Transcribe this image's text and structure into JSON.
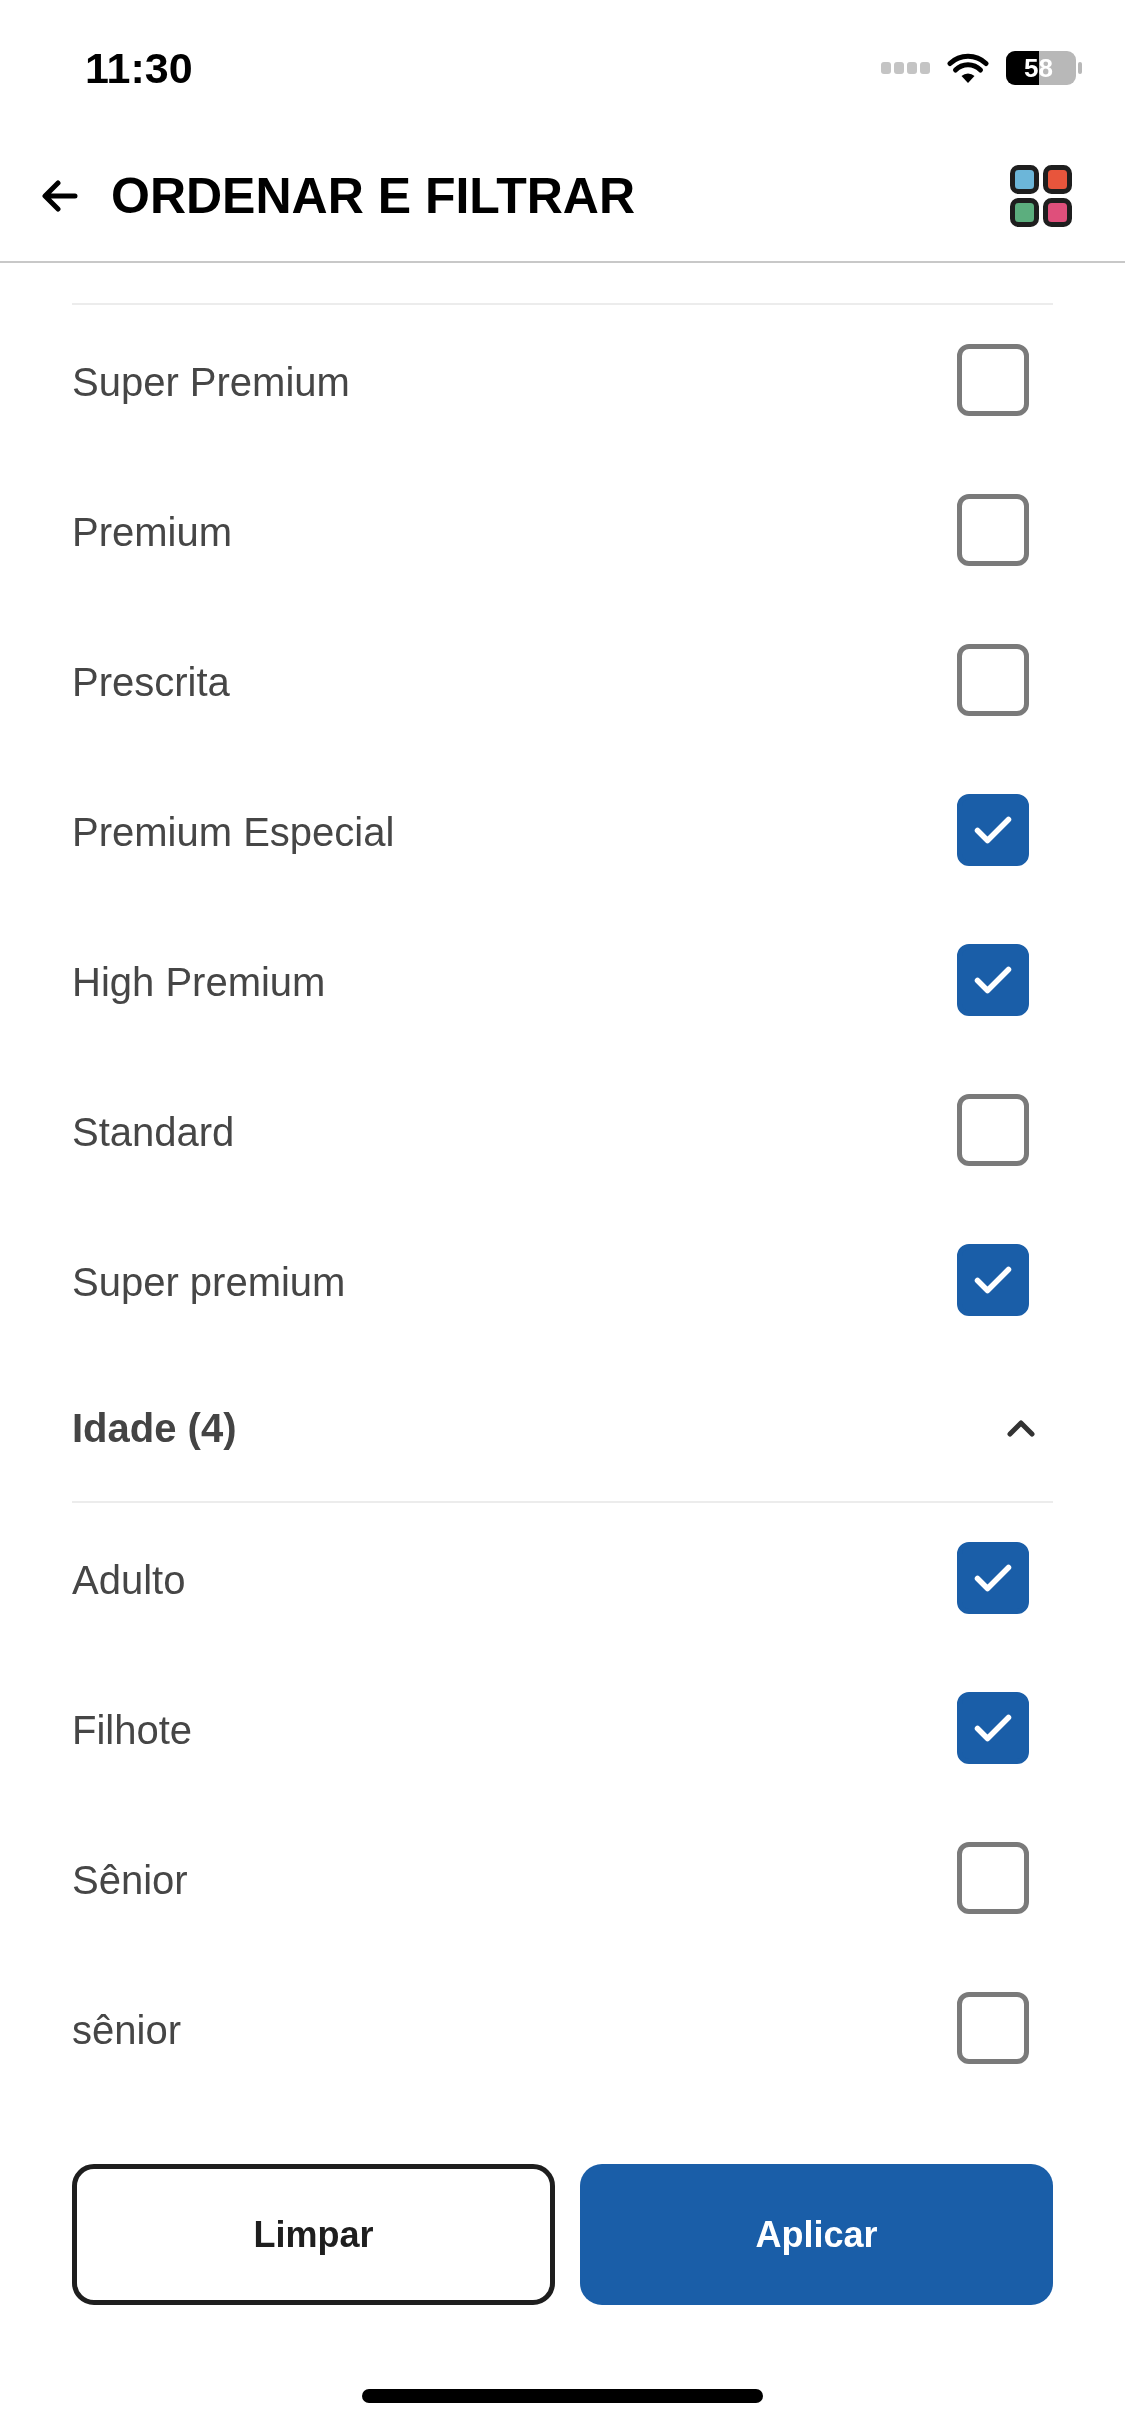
{
  "status_bar": {
    "time": "11:30",
    "battery_percent": "58"
  },
  "header": {
    "title": "ORDENAR E FILTRAR"
  },
  "filter_groups": [
    {
      "options": [
        {
          "label": "Super Premium",
          "checked": false
        },
        {
          "label": "Premium",
          "checked": false
        },
        {
          "label": "Prescrita",
          "checked": false
        },
        {
          "label": "Premium Especial",
          "checked": true
        },
        {
          "label": "High Premium",
          "checked": true
        },
        {
          "label": "Standard",
          "checked": false
        },
        {
          "label": "Super premium",
          "checked": true
        }
      ]
    },
    {
      "title": "Idade (4)",
      "expanded": true,
      "options": [
        {
          "label": "Adulto",
          "checked": true
        },
        {
          "label": "Filhote",
          "checked": true
        },
        {
          "label": "Sênior",
          "checked": false
        },
        {
          "label": "sênior",
          "checked": false
        }
      ]
    }
  ],
  "buttons": [
    {
      "label": "Limpar",
      "kind": "outline"
    },
    {
      "label": "Aplicar",
      "kind": "primary"
    }
  ]
}
